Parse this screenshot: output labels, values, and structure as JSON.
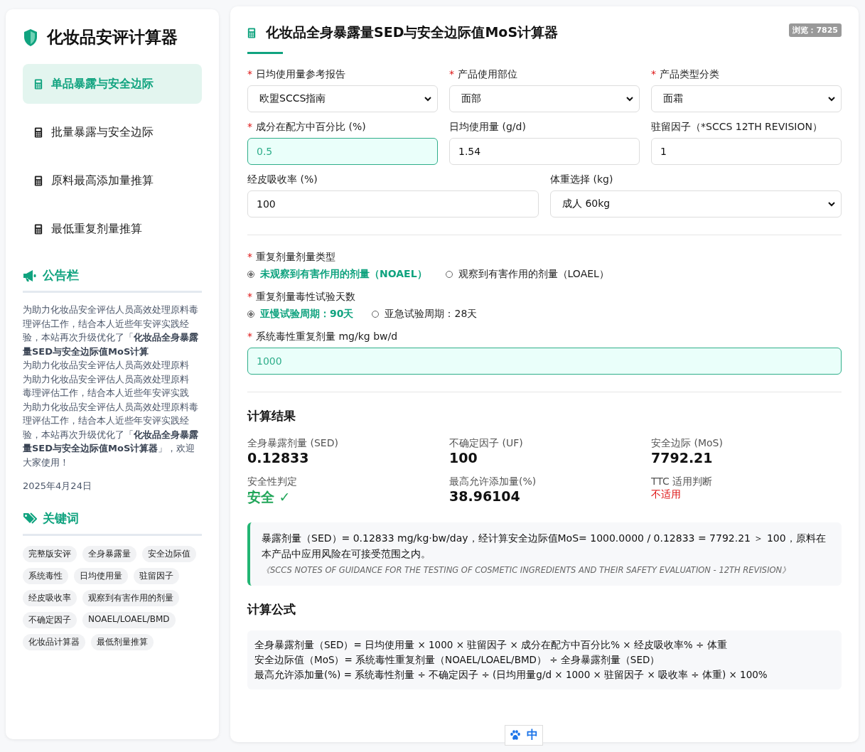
{
  "sidebar": {
    "title": "化妆品安评计算器",
    "nav": [
      {
        "label": "单品暴露与安全边际",
        "selected": true
      },
      {
        "label": "批量暴露与安全边际",
        "selected": false
      },
      {
        "label": "原料最高添加量推算",
        "selected": false
      },
      {
        "label": "最低重复剂量推算",
        "selected": false
      }
    ],
    "notice": {
      "title": "公告栏",
      "paragraphs": [
        "为助力化妆品安全评估人员高效处理原料毒理评估工作，结合本人近些年安评实践经验，本站再次升级优化了「**化妆品全身暴露量SED与安全边际值MoS计算**",
        "为助力化妆品安全评估人员高效处理原料",
        "为助力化妆品安全评估人员高效处理原料",
        "毒理评估工作，结合本人近些年安评实践",
        "为助力化妆品安全评估人员高效处理原料毒理评估工作，结合本人近些年安评实践经验，本站再次升级优化了「**化妆品全身暴露量SED与安全边际值MoS计算器**」，欢迎大家使用！"
      ],
      "date": "2025年4月24日"
    },
    "keywords": {
      "title": "关键词",
      "tags": [
        "完整版安评",
        "全身暴露量",
        "安全边际值",
        "系统毒性",
        "日均使用量",
        "驻留因子",
        "经皮吸收率",
        "观察到有害作用的剂量",
        "不确定因子",
        "NOAEL/LOAEL/BMD",
        "化妆品计算器",
        "最低剂量推算"
      ]
    }
  },
  "main": {
    "title": "化妆品全身暴露量SED与安全边际值MoS计算器",
    "views": "浏览：7825",
    "field_rows": [
      [
        {
          "kind": "select",
          "required_mark": "*",
          "label": "日均使用量参考报告",
          "value": "欧盟SCCS指南"
        },
        {
          "kind": "select",
          "required_mark": "*",
          "label": "产品使用部位",
          "value": "面部"
        },
        {
          "kind": "select",
          "required_mark": "*",
          "label": "产品类型分类",
          "value": "面霜"
        }
      ],
      [
        {
          "kind": "input",
          "required_mark": "*",
          "label": "成分在配方中百分比 (%)",
          "value": "0.5",
          "highlighted": true
        },
        {
          "kind": "input",
          "label": "日均使用量 (g/d)",
          "value": "1.54",
          "highlighted": false
        },
        {
          "kind": "input",
          "label": "驻留因子（*SCCS 12TH REVISION）",
          "value": "1",
          "highlighted": false
        }
      ],
      [
        {
          "kind": "input",
          "label": "经皮吸收率 (%)",
          "value": "100",
          "highlighted": false
        },
        {
          "kind": "select",
          "label": "体重选择 (kg)",
          "value": "成人 60kg"
        }
      ]
    ],
    "radio_groups": [
      {
        "required_mark": "*",
        "label": "重复剂量剂量类型",
        "options": [
          {
            "label": "未观察到有害作用的剂量（NOAEL）",
            "selected": true
          },
          {
            "label": "观察到有害作用的剂量（LOAEL）",
            "selected": false
          }
        ]
      },
      {
        "required_mark": "*",
        "label": "重复剂量毒性试验天数",
        "options": [
          {
            "label": "亚慢试验周期：90天",
            "selected": true
          },
          {
            "label": "亚急试验周期：28天",
            "selected": false
          }
        ]
      }
    ],
    "dose_field": {
      "kind": "input",
      "required_mark": "*",
      "label": "系统毒性重复剂量 mg/kg bw/d",
      "value": "1000",
      "highlighted": true
    },
    "results": {
      "title": "计算结果",
      "items": [
        {
          "label": "全身暴露剂量 (SED)",
          "value": "0.12833",
          "kind": "number"
        },
        {
          "label": "不确定因子 (UF)",
          "value": "100",
          "kind": "number"
        },
        {
          "label": "安全边际 (MoS)",
          "value": "7792.21",
          "kind": "number"
        },
        {
          "label": "安全性判定",
          "value": "安全 ✓",
          "kind": "safe"
        },
        {
          "label": "最高允许添加量(%)",
          "value": "38.96104",
          "kind": "number"
        },
        {
          "label": "TTC 适用判断",
          "value": "不适用",
          "kind": "warn"
        }
      ],
      "conclusion": "暴露剂量（SED）= 0.12833 mg/kg·bw/day，经计算安全边际值MoS= 1000.0000 / 0.12833 = 7792.21 ＞ 100，原料在本产品中应用风险在可接受范围之内。",
      "reference": "《SCCS NOTES OF GUIDANCE FOR THE TESTING OF COSMETIC INGREDIENTS AND THEIR SAFETY EVALUATION - 12TH REVISION》"
    },
    "formulas": {
      "title": "计算公式",
      "lines": [
        "全身暴露剂量（SED）= 日均使用量 × 1000 × 驻留因子 × 成分在配方中百分比% × 经皮吸收率% ÷ 体重",
        "安全边际值（MoS）= 系统毒性重复剂量（NOAEL/LOAEL/BMD） ÷ 全身暴露剂量（SED）",
        "最高允许添加量(%) = 系统毒性剂量 ÷ 不确定因子 ÷ (日均用量g/d × 1000 × 驻留因子 × 吸收率 ÷ 体重) × 100%"
      ]
    }
  },
  "language_badge": "中"
}
